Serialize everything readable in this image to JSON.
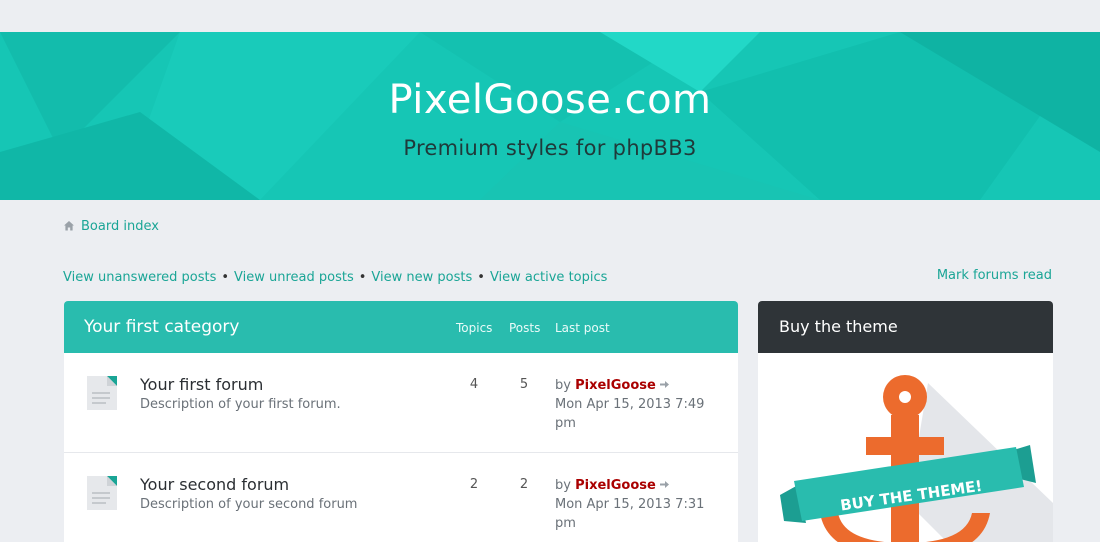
{
  "header": {
    "site_title": "PixelGoose.com",
    "site_description": "Premium styles for phpBB3",
    "bg_color": "#16c6b5"
  },
  "breadcrumb": {
    "icon": "home-icon",
    "label": "Board index"
  },
  "quicklinks": {
    "items": [
      "View unanswered posts",
      "View unread posts",
      "View new posts",
      "View active topics"
    ],
    "separator": "•",
    "mark_read": "Mark forums read"
  },
  "category": {
    "title": "Your first category",
    "columns": {
      "topics": "Topics",
      "posts": "Posts",
      "last_post": "Last post"
    },
    "forums": [
      {
        "name": "Your first forum",
        "description": "Description of your first forum.",
        "topics": "4",
        "posts": "5",
        "by": "by",
        "author": "PixelGoose",
        "date": "Mon Apr 15, 2013 7:49 pm"
      },
      {
        "name": "Your second forum",
        "description": "Description of your second forum",
        "topics": "2",
        "posts": "2",
        "by": "by",
        "author": "PixelGoose",
        "date": "Mon Apr 15, 2013 7:31 pm"
      }
    ]
  },
  "sidebar": {
    "title": "Buy the theme",
    "ribbon_text": "BUY THE THEME!"
  },
  "colors": {
    "accent": "#29bcae",
    "link": "#1aa596",
    "author": "#aa0000",
    "sidebar_head": "#2f3438",
    "anchor": "#ec6b2d"
  }
}
